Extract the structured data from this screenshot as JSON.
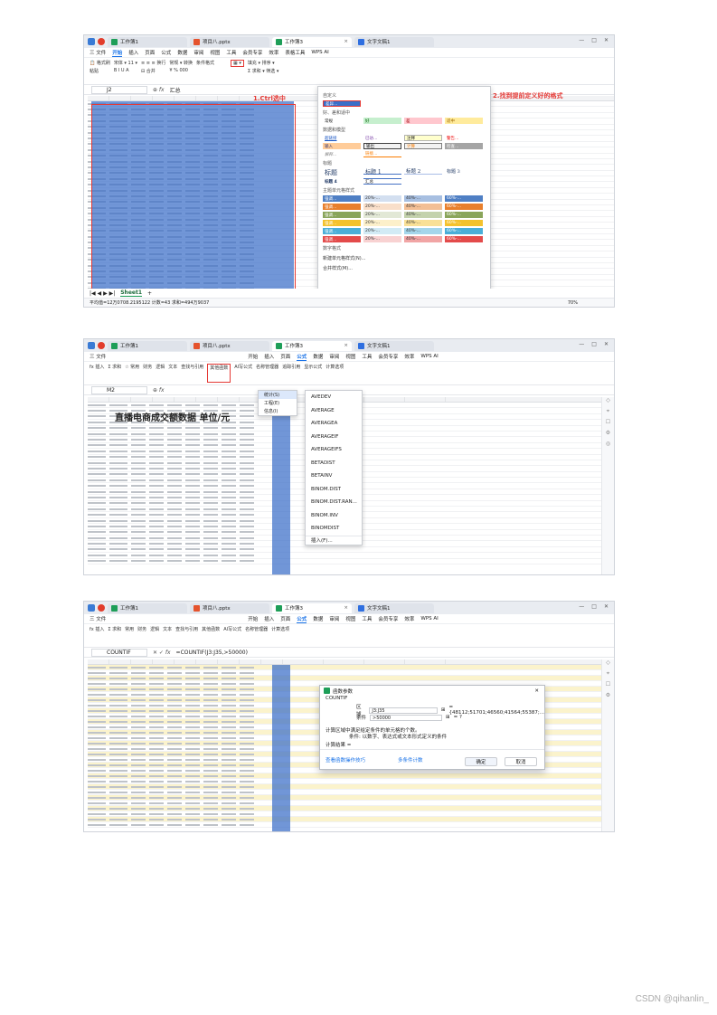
{
  "shot1": {
    "tabs": [
      "工作簿1",
      "项目八.pptx",
      "工作簿3",
      "文字文稿1"
    ],
    "menus": [
      "三 文件",
      "开始",
      "插入",
      "页面",
      "公式",
      "数据",
      "审阅",
      "视图",
      "工具",
      "会员专享",
      "效率",
      "表格工具",
      "WPS AI"
    ],
    "active_menu": "开始",
    "name_box": "J2",
    "formula": "汇总",
    "annotation1": "1.Ctrl选中",
    "annotation2": "2.找到提前定义好的格式",
    "sheet_tab": "Sheet1",
    "status": "平均值=12万0708.2195122  计数=43  求和=494万9037",
    "zoom": "70%",
    "style_panel": {
      "custom_header": "自定义",
      "custom_chip": "差异…",
      "good_bad_header": "好、差和适中",
      "good_bad": [
        "常规",
        "好",
        "差",
        "适中"
      ],
      "data_model_header": "数据和模型",
      "data_model": [
        "超链接",
        "已访…",
        "注释",
        "警告…",
        "输入",
        "输出",
        "计算",
        "检查…",
        "解释…",
        "链接…"
      ],
      "title_header": "标题",
      "titles": [
        "标题",
        "标题 1",
        "标题 2",
        "标题 3",
        "标题 4",
        "汇总"
      ],
      "theme_header": "主题单元格样式",
      "theme_chips": [
        "强调…",
        "20%-…",
        "40%-…",
        "60%-…"
      ],
      "number_header": "数字格式",
      "new_style": "新建单元格样式(N)...",
      "merge_style": "合并样式(M)..."
    },
    "colors": {
      "theme": [
        "#4f7fc4",
        "#e87f2c",
        "#8aa55a",
        "#f4c22d",
        "#4aaed8",
        "#e34b4b"
      ]
    }
  },
  "shot2": {
    "tabs": [
      "工作簿1",
      "项目八.pptx",
      "工作簿3",
      "文字文稿1"
    ],
    "active_menu": "公式",
    "name_box": "M2",
    "title_cell": "直播电商成交额数据  单位/元",
    "ribbon": [
      "插入",
      "求和",
      "常用",
      "财务",
      "逻辑",
      "文本",
      "查找与引用",
      "其他函数",
      "AI写公式",
      "名称管理器",
      "追踪引用",
      "显示公式",
      "计算选项"
    ],
    "other_fn_menu": [
      "统计(S)",
      "工程(E)",
      "信息(I)"
    ],
    "fn_list": [
      "AVEDEV",
      "AVERAGE",
      "AVERAGEA",
      "AVERAGEIF",
      "AVERAGEIFS",
      "BETADIST",
      "BETAINV",
      "BINOM.DIST",
      "BINOM.DIST.RAN...",
      "BINOM.INV",
      "BINOMDIST",
      "插入(F)..."
    ]
  },
  "shot3": {
    "name_box": "COUNTIF",
    "formula": "=COUNTIF(J3:J35,>50000)",
    "dialog": {
      "title": "函数参数",
      "fn": "COUNTIF",
      "range_label": "区域",
      "range_value": "J3:J35",
      "range_result": "= {48112;51701;46560;41564;55387;...",
      "criteria_label": "条件",
      "criteria_value": ">50000",
      "criteria_result": "= ?",
      "desc1": "计算区域中满足给定条件的单元格的个数。",
      "desc2": "条件: 以数字、表达式或文本形式定义的条件",
      "result_label": "计算结果 =",
      "help": "查看函数操作技巧",
      "multi": "多条件计数",
      "ok": "确定",
      "cancel": "取消"
    }
  },
  "watermark": "CSDN @qihanlin_"
}
